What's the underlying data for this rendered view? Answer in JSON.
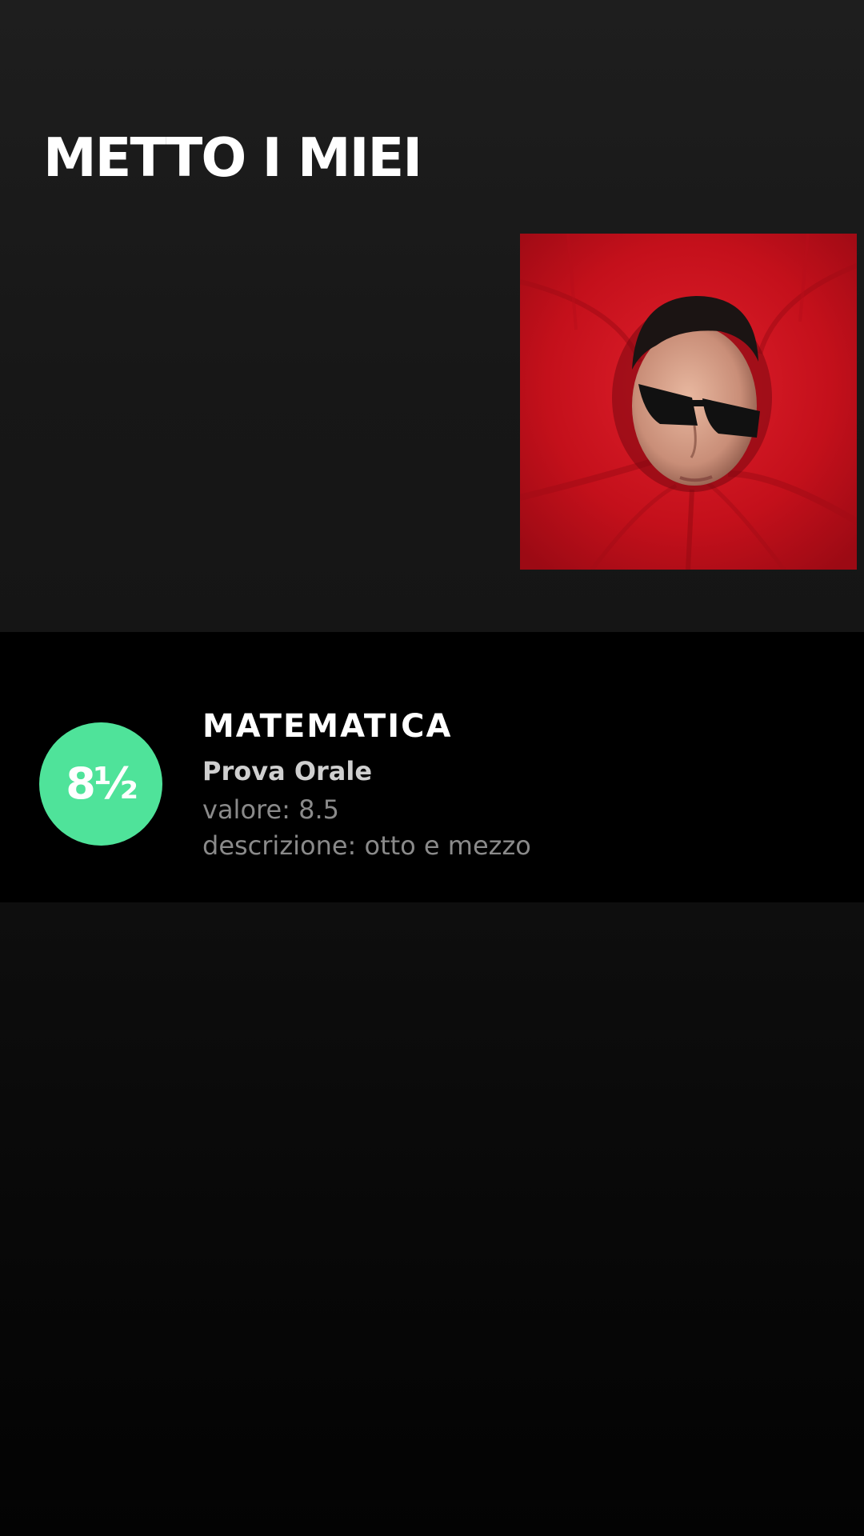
{
  "header": {
    "title": "METTO I MIEI"
  },
  "grade": {
    "badge": "8½",
    "badge_color": "#4fe39a",
    "subject": "MATEMATICA",
    "type": "Prova Orale",
    "value_line": "valore: 8.5",
    "description_line": "descrizione: otto e mezzo",
    "value": 8.5
  },
  "colors": {
    "accent": "#4fe39a",
    "cover_background": "#c9101c"
  }
}
